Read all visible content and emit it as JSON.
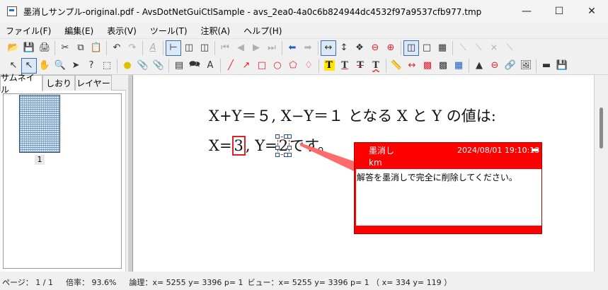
{
  "window": {
    "title": "墨消しサンプル-original.pdf - AvsDotNetGuiCtlSample - avs_2ea0-4a0c6b824944dc4532f97a9537cfb977.tmp",
    "minimize_glyph": "—",
    "maximize_glyph": "☐",
    "close_glyph": "✕"
  },
  "menu": [
    "ファイル(F)",
    "編集(E)",
    "表示(V)",
    "ツール(T)",
    "注釈(A)",
    "ヘルプ(H)"
  ],
  "toolbar1": {
    "icons": [
      "open-folder-icon",
      "save-icon",
      "print-icon",
      "cut-icon",
      "copy-icon",
      "paste-icon",
      "undo-icon",
      "redo-icon",
      "text-style-icon",
      "fit-width-icon",
      "two-page-icon",
      "continuous-page-icon",
      "first-page-icon",
      "previous-page-icon",
      "next-page-icon",
      "last-page-icon",
      "back-icon",
      "forward-icon",
      "fit-page-width-icon",
      "fit-page-height-icon",
      "actual-size-icon",
      "zoom-out-icon",
      "zoom-in-icon",
      "single-page-view-icon",
      "full-page-view-icon",
      "grid-view-icon",
      "line-tool-disabled-icon",
      "arrow-tool-disabled-icon",
      "cross-line-disabled-icon",
      "slash-line-disabled-icon"
    ]
  },
  "toolbar2": {
    "icons": [
      "select-arrow-icon",
      "text-select-icon",
      "hand-pan-icon",
      "zoom-select-icon",
      "pointer-icon",
      "help-pointer-icon",
      "marquee-select-icon",
      "sticky-note-icon",
      "paperclip-icon",
      "attachment-icon",
      "textbox-icon",
      "callout-icon",
      "typewriter-icon",
      "line-icon",
      "arrow-icon",
      "rectangle-icon",
      "ellipse-icon",
      "polygon-icon",
      "polyline-icon",
      "highlight-text-icon",
      "underline-text-icon",
      "strikethrough-text-icon",
      "squiggly-text-icon",
      "ruler-icon",
      "measure-distance-icon",
      "measure-area-icon",
      "measure-perimeter-icon",
      "grid-icon",
      "stamp-icon",
      "no-entry-icon",
      "link-icon",
      "image-icon",
      "redaction-icon",
      "save-redaction-icon"
    ],
    "text_tool_letter": "T"
  },
  "left_panel": {
    "tabs": [
      "サムネイル",
      "しおり",
      "レイヤー"
    ],
    "thumbnail_page_label": "1"
  },
  "document": {
    "line1": "X+Y＝５, X−Y＝１ となる X と Y の値は:",
    "line2_prefix": "X=",
    "line2_answer_x": "3",
    "line2_middle": ", Y=",
    "line2_answer_y": "2",
    "line2_suffix": "です。"
  },
  "note": {
    "title": "墨消し",
    "date": "2024/08/01 19:10:13",
    "author": "km",
    "body": "解答を墨消しで完全に削除してください。",
    "color": "#ff0000"
  },
  "status": {
    "page": "ページ：  1 / 1",
    "zoom": "倍率：  93.6%",
    "logical": "論理：x= 5255 y= 3396 p= 1",
    "view": "ビュー：x= 5255 y= 3396 p= 1 （ x= 334 y= 119 ）"
  }
}
